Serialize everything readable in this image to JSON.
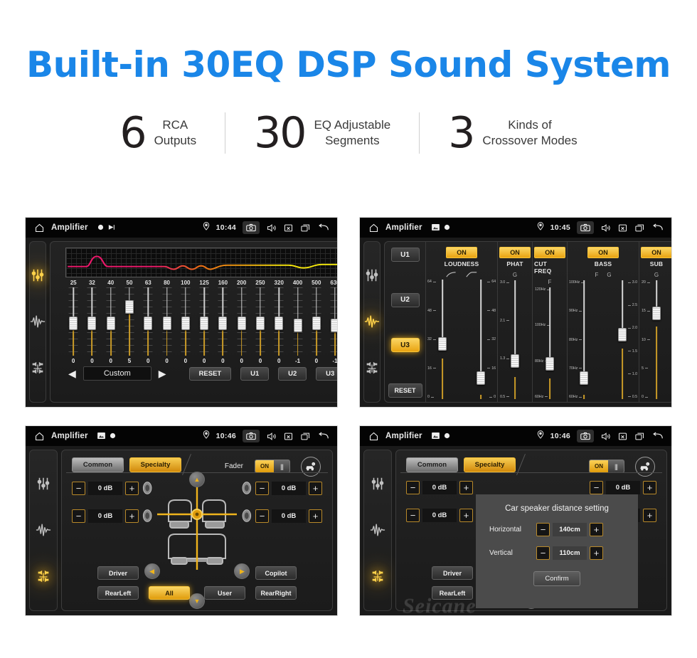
{
  "hero": {
    "title": "Built-in 30EQ DSP Sound System",
    "stats": [
      {
        "number": "6",
        "text": "RCA\nOutputs"
      },
      {
        "number": "30",
        "text": "EQ Adjustable\nSegments"
      },
      {
        "number": "3",
        "text": "Kinds of\nCrossover Modes"
      }
    ]
  },
  "colors": {
    "heading_blue": "#1a86e8",
    "accent_gold": "#e9a311",
    "panel_dark": "#1a1a1a",
    "status_bar": "#040404"
  },
  "panels": {
    "eq": {
      "statusbar": {
        "home_icon": "home-icon",
        "title": "Amplifier",
        "mini_icons": [
          "dot-icon",
          "play-badge-icon"
        ],
        "location_icon": "location-pin-icon",
        "time": "10:44",
        "right_icons": [
          "camera-icon",
          "volume-icon",
          "close-box-icon",
          "recent-apps-icon",
          "back-arrow-icon"
        ]
      },
      "rail_icons": [
        "equalizer-icon",
        "waveform-icon",
        "balance-icon"
      ],
      "rail_active_index": 0,
      "frequencies": [
        "25",
        "32",
        "40",
        "50",
        "63",
        "80",
        "100",
        "125",
        "160",
        "200",
        "250",
        "320",
        "400",
        "500",
        "630"
      ],
      "values": [
        "0",
        "0",
        "0",
        "5",
        "0",
        "0",
        "0",
        "0",
        "0",
        "0",
        "0",
        "0",
        "-1",
        "0",
        "-1"
      ],
      "knob_positions": [
        50,
        50,
        50,
        78,
        50,
        50,
        50,
        50,
        50,
        50,
        50,
        50,
        46,
        50,
        46
      ],
      "prev_label": "◀",
      "next_label": "▶",
      "preset": "Custom",
      "reset_label": "RESET",
      "user_presets": [
        "U1",
        "U2",
        "U3"
      ],
      "expand_icon": "chevron-double-right-icon"
    },
    "loudness": {
      "statusbar": {
        "title": "Amplifier",
        "time": "10:45",
        "mini_icons": [
          "image-icon",
          "dot-icon"
        ]
      },
      "rail_active_index": 1,
      "presets": [
        "U1",
        "U2",
        "U3"
      ],
      "active_preset": "U3",
      "reset_label": "RESET",
      "bands": [
        {
          "name": "LOUDNESS",
          "state": "ON",
          "sub": [
            "curve-low-icon",
            "curve-high-icon"
          ],
          "scale_left": [
            "64",
            "48",
            "32",
            "16",
            "0"
          ],
          "scale_right": [
            "64",
            "48",
            "32",
            "16",
            "0"
          ],
          "knob_left_pct": 40,
          "knob_right_pct": 4
        },
        {
          "name": "PHAT",
          "state": "ON",
          "sub": [
            "G"
          ],
          "scale_left": [
            "3.0",
            "2.1",
            "1.3",
            "0.5"
          ],
          "knob_left_pct": 22
        },
        {
          "name": "CUT FREQ",
          "state": "ON",
          "sub": [
            "F"
          ],
          "scale_left": [
            "120Hz",
            "100Hz",
            "80Hz",
            "60Hz"
          ],
          "knob_left_pct": 22
        },
        {
          "name": "BASS",
          "state": "ON",
          "sub": [
            "F",
            "G"
          ],
          "scale_left": [
            "100Hz",
            "90Hz",
            "80Hz",
            "70Hz",
            "60Hz"
          ],
          "scale_right": [
            "3.0",
            "2.5",
            "2.0",
            "1.5",
            "1.0",
            "0.5"
          ],
          "knob_left_pct": 4,
          "knob_right_pct": 50
        },
        {
          "name": "SUB",
          "state": "ON",
          "sub": [
            "G"
          ],
          "scale_left": [
            "20",
            "15",
            "10",
            "5",
            "0"
          ],
          "knob_left_pct": 72
        }
      ]
    },
    "fader": {
      "statusbar": {
        "title": "Amplifier",
        "time": "10:46"
      },
      "rail_active_index": 2,
      "tabs": [
        {
          "label": "Common",
          "active": false
        },
        {
          "label": "Specialty",
          "active": true
        }
      ],
      "fader_label": "Fader",
      "toggle_state": "ON",
      "car_settings_icon": "car-settings-icon",
      "db_values": [
        "0 dB",
        "0 dB",
        "0 dB",
        "0 dB"
      ],
      "minus_label": "−",
      "plus_label": "+",
      "buttons": [
        {
          "label": "Driver",
          "active": false
        },
        {
          "label": "Copilot",
          "active": false
        },
        {
          "label": "RearLeft",
          "active": false
        },
        {
          "label": "RearRight",
          "active": false
        },
        {
          "label": "All",
          "active": true
        },
        {
          "label": "User",
          "active": false
        }
      ],
      "direction_icons": [
        "arrow-up-icon",
        "arrow-down-icon",
        "arrow-left-icon",
        "arrow-right-icon"
      ],
      "seats_icon": "car-seats-diagram-icon"
    },
    "dialog": {
      "statusbar": {
        "title": "Amplifier",
        "time": "10:46"
      },
      "title": "Car speaker distance setting",
      "rows": [
        {
          "label": "Horizontal",
          "value": "140cm"
        },
        {
          "label": "Vertical",
          "value": "110cm"
        }
      ],
      "minus_label": "−",
      "plus_label": "+",
      "confirm_label": "Confirm",
      "watermark": "Seicane"
    }
  }
}
